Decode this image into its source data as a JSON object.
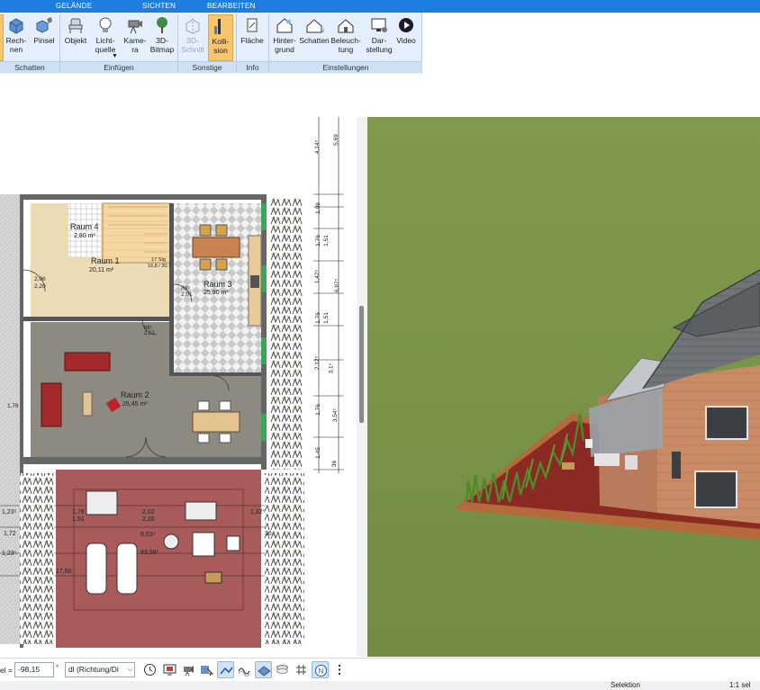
{
  "ribbon": {
    "tabs": [
      "GELÄNDE",
      "SICHTEN",
      "BEARBEITEN"
    ],
    "buttons": {
      "rechnen": "Rech-\nnen",
      "pinsel": "Pinsel",
      "objekt": "Objekt",
      "lichtquelle": "Licht-\nquelle",
      "kamera": "Kame-\nra",
      "bitmap3d": "3D-\nBitmap",
      "schnitt3d": "3D-\nSchnitt",
      "kollision": "Kolli-\nsion",
      "flaeche": "Fläche",
      "hintergrund": "Hinter-\ngrund",
      "schatten": "Schatten",
      "beleuchtung": "Beleuch-\ntung",
      "darstellung": "Dar-\nstellung",
      "video": "Video"
    },
    "groups": {
      "schatten": "Schatten",
      "einfuegen": "Einfügen",
      "sonstige": "Sonstige",
      "info": "Info",
      "einstellungen": "Einstellungen"
    },
    "colors": {
      "tab_bar": "#1e7ee0",
      "ribbon_bg": "#e4effb",
      "active": "#f7c66c"
    }
  },
  "plan": {
    "rooms": [
      {
        "name": "Raum 4",
        "area": "2,80 m²"
      },
      {
        "name": "Raum 1",
        "area": "20,11 m²"
      },
      {
        "name": "Raum 3",
        "area": "25,90 m²"
      },
      {
        "name": "Raum 2",
        "area": "26,45 m²"
      }
    ],
    "right_ruler": [
      "5,69",
      "4,14⁵",
      "1,09",
      "1,76",
      "1,51",
      "1,42⁵",
      "6,97⁵",
      "1,76",
      "1,51",
      "2,12⁵",
      "3,1⁵",
      "1,76",
      "3,54⁵",
      "1,45",
      "36"
    ],
    "terrace_dims": [
      "1,23⁵",
      "1,78",
      "1,51",
      "2,02",
      "2,20",
      "1,32⁵",
      "1,72",
      "9,63⁵",
      "1,23⁵",
      "36",
      "93,56²",
      "17,60"
    ],
    "small_labels": [
      "2,06",
      "2,20",
      "88⁵",
      "2,01",
      "88⁵",
      "2,01",
      "1,76",
      "17 Stg",
      "16,8 / 30,7"
    ]
  },
  "bottombar": {
    "field_prefix": "el =",
    "value": "-98,15",
    "unit": "°",
    "dropdown": "dl (Richtung/Di"
  },
  "status": {
    "mode": "Selektion",
    "scale": "1:1 sel"
  },
  "icons": [
    "clock-icon",
    "monitor-icon",
    "camera-icon",
    "cursor-icon",
    "line-icon",
    "wave-icon",
    "surface-icon",
    "layer-icon",
    "grid-icon",
    "north-icon",
    "more-icon"
  ]
}
